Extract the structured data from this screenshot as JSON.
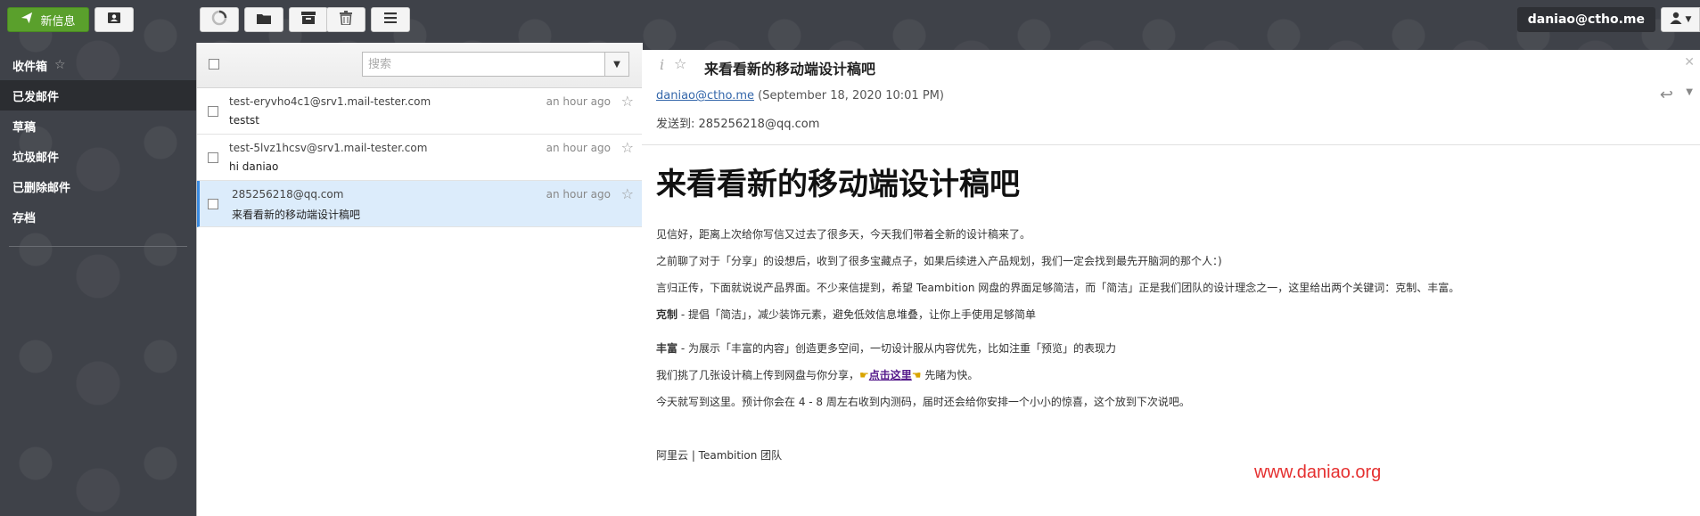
{
  "toolbar": {
    "new_label": "新信息",
    "user_email": "daniao@ctho.me"
  },
  "sidebar": {
    "items": [
      {
        "label": "收件箱"
      },
      {
        "label": "已发邮件"
      },
      {
        "label": "草稿"
      },
      {
        "label": "垃圾邮件"
      },
      {
        "label": "已删除邮件"
      },
      {
        "label": "存档"
      }
    ]
  },
  "list": {
    "search_placeholder": "搜索",
    "messages": [
      {
        "from": "test-eryvho4c1@srv1.mail-tester.com",
        "subject": "testst",
        "time": "an hour ago"
      },
      {
        "from": "test-5lvz1hcsv@srv1.mail-tester.com",
        "subject": "hi daniao",
        "time": "an hour ago"
      },
      {
        "from": "285256218@qq.com",
        "subject": "来看看新的移动端设计稿吧",
        "time": "an hour ago"
      }
    ]
  },
  "reader": {
    "subject": "来看看新的移动端设计稿吧",
    "from": "daniao@ctho.me",
    "date": "(September 18, 2020 10:01 PM)",
    "to": "发送到: 285256218@qq.com",
    "body": {
      "heading": "来看看新的移动端设计稿吧",
      "p1": "见信好，距离上次给你写信又过去了很多天，今天我们带着全新的设计稿来了。",
      "p2": "之前聊了对于「分享」的设想后，收到了很多宝藏点子，如果后续进入产品规划，我们一定会找到最先开脑洞的那个人：)",
      "p3": "言归正传，下面就说说产品界面。不少来信提到，希望 Teambition 网盘的界面足够简洁，而「简洁」正是我们团队的设计理念之一，这里给出两个关键词：克制、丰富。",
      "p4_strong": "克制",
      "p4_rest": " - 提倡「简洁」，减少装饰元素，避免低效信息堆叠，让你上手使用足够简单",
      "p5_strong": "丰富",
      "p5_rest": " - 为展示「丰富的内容」创造更多空间，一切设计服从内容优先，比如注重「预览」的表现力",
      "p6_pre": "我们挑了几张设计稿上传到网盘与你分享，",
      "p6_link": "点击这里",
      "p6_post": " 先睹为快。",
      "p7": "今天就写到这里。预计你会在 4 - 8 周左右收到内测码，届时还会给你安排一个小小的惊喜，这个放到下次说吧。",
      "signature": "阿里云 | Teambition 团队"
    }
  },
  "watermark": "www.daniao.org"
}
